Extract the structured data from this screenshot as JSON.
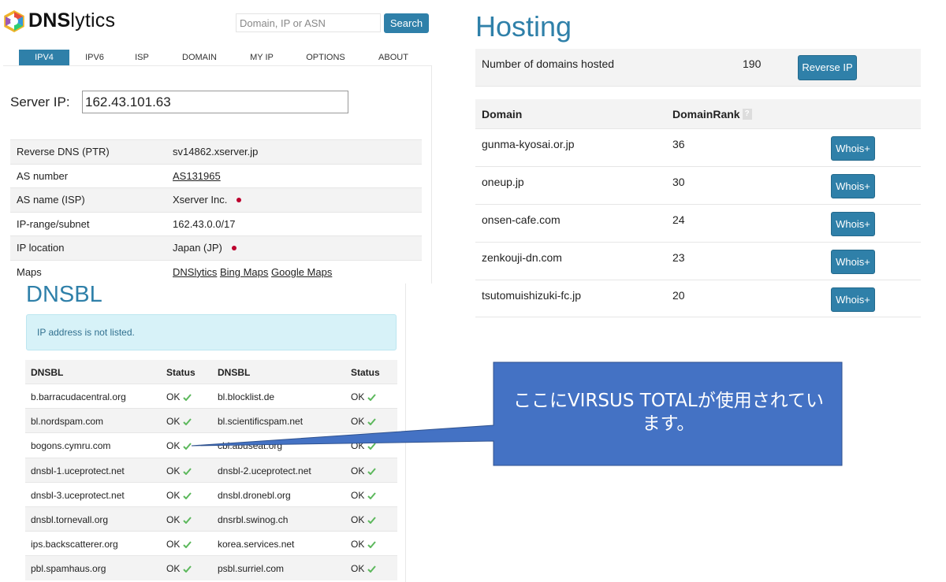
{
  "header": {
    "logo_text_bold": "DNS",
    "logo_text_rest": "lytics",
    "search_placeholder": "Domain, IP or ASN",
    "search_button": "Search"
  },
  "nav": {
    "items": [
      {
        "label": "IPV4",
        "active": true
      },
      {
        "label": "IPV6",
        "active": false
      },
      {
        "label": "ISP",
        "active": false
      },
      {
        "label": "DOMAIN",
        "active": false
      },
      {
        "label": "MY IP",
        "active": false
      },
      {
        "label": "OPTIONS",
        "active": false
      },
      {
        "label": "ABOUT",
        "active": false
      }
    ]
  },
  "server": {
    "label": "Server IP:",
    "value": "162.43.101.63"
  },
  "info": {
    "rows": [
      {
        "key": "Reverse DNS (PTR)",
        "value": "sv14862.xserver.jp"
      },
      {
        "key": "AS number",
        "value": "AS131965"
      },
      {
        "key": "AS name (ISP)",
        "value": "Xserver Inc."
      },
      {
        "key": "IP-range/subnet",
        "value": "162.43.0.0/17"
      },
      {
        "key": "IP location",
        "value": "Japan (JP)"
      },
      {
        "key": "Maps",
        "links": [
          "DNSlytics",
          "Bing Maps",
          "Google Maps"
        ]
      }
    ]
  },
  "dnsbl": {
    "title": "DNSBL",
    "alert": "IP address is not listed.",
    "headers": [
      "DNSBL",
      "Status",
      "DNSBL",
      "Status"
    ],
    "rows": [
      [
        "b.barracudacentral.org",
        "OK",
        "bl.blocklist.de",
        "OK"
      ],
      [
        "bl.nordspam.com",
        "OK",
        "bl.scientificspam.net",
        "OK"
      ],
      [
        "bogons.cymru.com",
        "OK",
        "cbl.abuseat.org",
        "OK"
      ],
      [
        "dnsbl-1.uceprotect.net",
        "OK",
        "dnsbl-2.uceprotect.net",
        "OK"
      ],
      [
        "dnsbl-3.uceprotect.net",
        "OK",
        "dnsbl.dronebl.org",
        "OK"
      ],
      [
        "dnsbl.tornevall.org",
        "OK",
        "dnsrbl.swinog.ch",
        "OK"
      ],
      [
        "ips.backscatterer.org",
        "OK",
        "korea.services.net",
        "OK"
      ],
      [
        "pbl.spamhaus.org",
        "OK",
        "psbl.surriel.com",
        "OK"
      ]
    ]
  },
  "hosting": {
    "title": "Hosting",
    "count_label": "Number of domains hosted",
    "count": "190",
    "reverse_button": "Reverse IP",
    "col_domain": "Domain",
    "col_rank": "DomainRank",
    "help": "?",
    "whois_label": "Whois+",
    "rows": [
      {
        "domain": "gunma-kyosai.or.jp",
        "rank": "36"
      },
      {
        "domain": "oneup.jp",
        "rank": "30"
      },
      {
        "domain": "onsen-cafe.com",
        "rank": "24"
      },
      {
        "domain": "zenkouji-dn.com",
        "rank": "23"
      },
      {
        "domain": "tsutomuishizuki-fc.jp",
        "rank": "20"
      }
    ]
  },
  "callout": {
    "text": "ここにVIRSUS TOTALが使用されています。"
  },
  "colors": {
    "accent": "#2f80a9",
    "callout_fill": "#4472c4",
    "check": "#5cb85c",
    "flag_red": "#bc002d"
  }
}
